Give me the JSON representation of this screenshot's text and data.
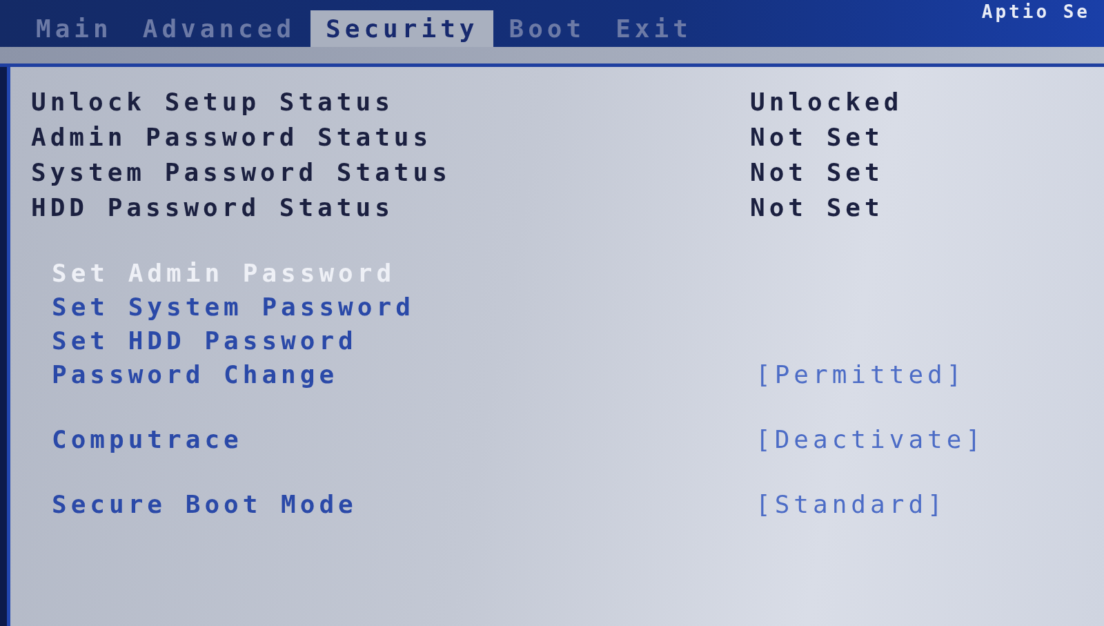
{
  "header": {
    "title": "Aptio Se"
  },
  "tabs": [
    {
      "label": "Main",
      "selected": false
    },
    {
      "label": "Advanced",
      "selected": false
    },
    {
      "label": "Security",
      "selected": true
    },
    {
      "label": "Boot",
      "selected": false
    },
    {
      "label": "Exit",
      "selected": false
    }
  ],
  "status_rows": [
    {
      "label": "Unlock Setup Status",
      "value": "Unlocked"
    },
    {
      "label": "Admin Password Status",
      "value": "Not Set"
    },
    {
      "label": "System Password Status",
      "value": "Not Set"
    },
    {
      "label": "HDD Password Status",
      "value": "Not Set"
    }
  ],
  "setting_groups": [
    {
      "items": [
        {
          "label": "Set Admin Password",
          "selected": true
        },
        {
          "label": "Set System Password",
          "selected": false
        },
        {
          "label": "Set HDD Password",
          "selected": false
        },
        {
          "label": "Password Change",
          "value": "[Permitted]",
          "selected": false
        }
      ]
    },
    {
      "items": [
        {
          "label": "Computrace",
          "value": "[Deactivate]",
          "selected": false
        }
      ]
    },
    {
      "items": [
        {
          "label": "Secure Boot Mode",
          "value": "[Standard]",
          "selected": false
        }
      ]
    }
  ]
}
